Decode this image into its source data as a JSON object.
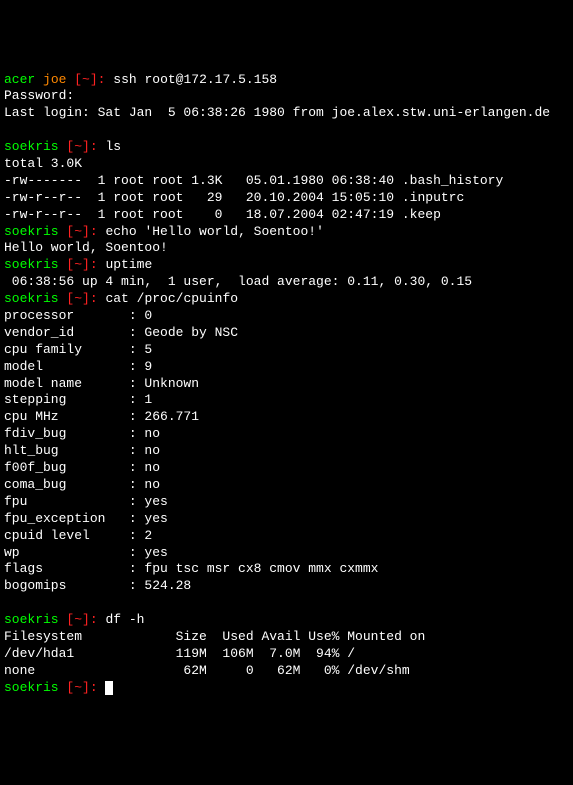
{
  "lines": [
    {
      "host": "acer",
      "user": "joe",
      "path": "[~]:",
      "cmd": " ssh root@172.17.5.158"
    },
    {
      "text": "Password:"
    },
    {
      "text": "Last login: Sat Jan  5 06:38:26 1980 from joe.alex.stw.uni-erlangen.de"
    },
    {
      "text": ""
    },
    {
      "host": "soekris",
      "path": "[~]:",
      "cmd": " ls"
    },
    {
      "text": "total 3.0K"
    },
    {
      "text": "-rw-------  1 root root 1.3K   05.01.1980 06:38:40 .bash_history"
    },
    {
      "text": "-rw-r--r--  1 root root   29   20.10.2004 15:05:10 .inputrc"
    },
    {
      "text": "-rw-r--r--  1 root root    0   18.07.2004 02:47:19 .keep"
    },
    {
      "host": "soekris",
      "path": "[~]:",
      "cmd": " echo 'Hello world, Soentoo!'"
    },
    {
      "text": "Hello world, Soentoo!"
    },
    {
      "host": "soekris",
      "path": "[~]:",
      "cmd": " uptime"
    },
    {
      "text": " 06:38:56 up 4 min,  1 user,  load average: 0.11, 0.30, 0.15"
    },
    {
      "host": "soekris",
      "path": "[~]:",
      "cmd": " cat /proc/cpuinfo"
    },
    {
      "text": "processor       : 0"
    },
    {
      "text": "vendor_id       : Geode by NSC"
    },
    {
      "text": "cpu family      : 5"
    },
    {
      "text": "model           : 9"
    },
    {
      "text": "model name      : Unknown"
    },
    {
      "text": "stepping        : 1"
    },
    {
      "text": "cpu MHz         : 266.771"
    },
    {
      "text": "fdiv_bug        : no"
    },
    {
      "text": "hlt_bug         : no"
    },
    {
      "text": "f00f_bug        : no"
    },
    {
      "text": "coma_bug        : no"
    },
    {
      "text": "fpu             : yes"
    },
    {
      "text": "fpu_exception   : yes"
    },
    {
      "text": "cpuid level     : 2"
    },
    {
      "text": "wp              : yes"
    },
    {
      "text": "flags           : fpu tsc msr cx8 cmov mmx cxmmx"
    },
    {
      "text": "bogomips        : 524.28"
    },
    {
      "text": ""
    },
    {
      "host": "soekris",
      "path": "[~]:",
      "cmd": " df -h"
    },
    {
      "text": "Filesystem            Size  Used Avail Use% Mounted on"
    },
    {
      "text": "/dev/hda1             119M  106M  7.0M  94% /"
    },
    {
      "text": "none                   62M     0   62M   0% /dev/shm"
    },
    {
      "host": "soekris",
      "path": "[~]:",
      "cmd": " ",
      "cursor": true
    }
  ]
}
